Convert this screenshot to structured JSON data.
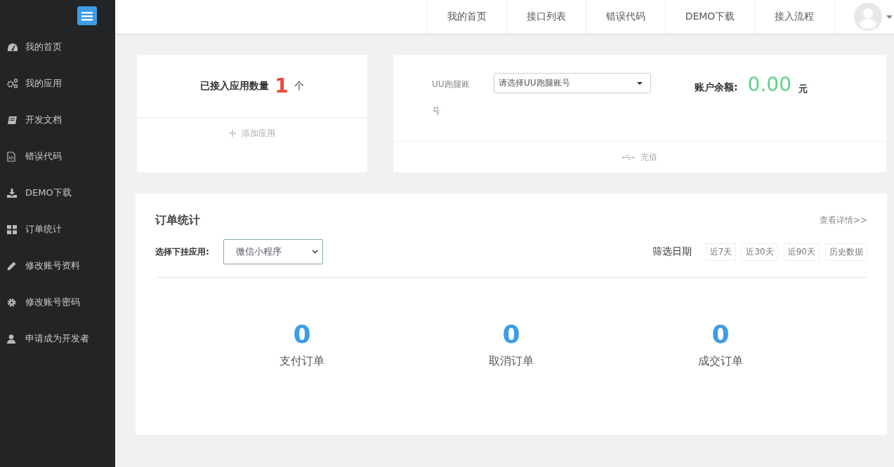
{
  "sidebar": {
    "items": [
      {
        "label": "我的首页"
      },
      {
        "label": "我的应用"
      },
      {
        "label": "开发文档"
      },
      {
        "label": "错误代码"
      },
      {
        "label": "DEMO下载"
      },
      {
        "label": "订单统计"
      },
      {
        "label": "修改账号资料"
      },
      {
        "label": "修改账号密码"
      },
      {
        "label": "申请成为开发者"
      }
    ]
  },
  "top_nav": {
    "items": [
      "我的首页",
      "接口列表",
      "错误代码",
      "DEMO下载",
      "接入流程"
    ]
  },
  "apps_card": {
    "label": "已接入应用数量",
    "count": "1",
    "unit": "个",
    "action": "添加应用"
  },
  "account_card": {
    "label": "UU跑腿账号",
    "select": {
      "placeholder": "请选择UU跑腿账号"
    },
    "balance_label": "账户余额:",
    "balance": "0.00",
    "unit": "元",
    "action": "充值"
  },
  "orders": {
    "title": "订单统计",
    "details_link": "查看详情>>",
    "app_label": "选择下挂应用:",
    "app_select": "微信小程序",
    "filter_label": "筛选日期",
    "filters": [
      "近7天",
      "近30天",
      "近90天",
      "历史数据"
    ],
    "stats": [
      {
        "value": "0",
        "label": "支付订单"
      },
      {
        "value": "0",
        "label": "取消订单"
      },
      {
        "value": "0",
        "label": "成交订单"
      }
    ]
  }
}
